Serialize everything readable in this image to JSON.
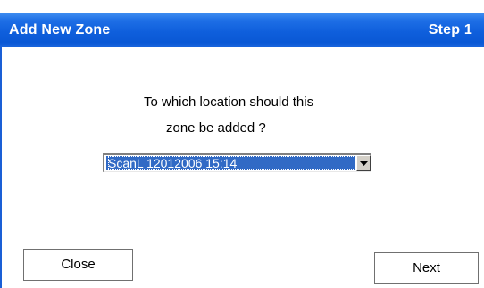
{
  "dialog": {
    "title": "Add New Zone",
    "step": "Step 1"
  },
  "prompt": {
    "line1": "To which location should this",
    "line2": "zone be added ?"
  },
  "location_select": {
    "selected": "ScanL 12012006 15:14"
  },
  "buttons": {
    "close_label": "Close",
    "next_label": "Next"
  },
  "colors": {
    "titlebar": "#0a58d5",
    "selection": "#316ac5"
  }
}
